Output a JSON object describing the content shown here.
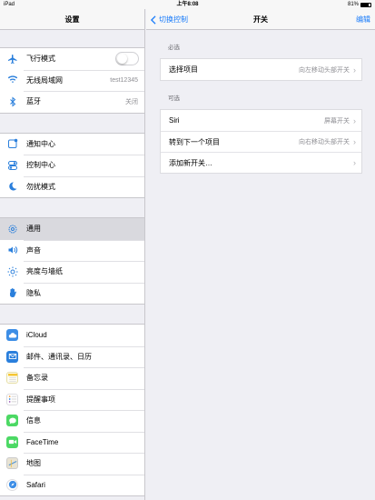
{
  "status_bar": {
    "device": "iPad",
    "time": "上午8:08",
    "battery": "81%",
    "battery_level": 0.81
  },
  "master": {
    "title": "设置",
    "groups": [
      [
        {
          "icon": "airplane-icon",
          "label": "飞行模式",
          "toggle": false
        },
        {
          "icon": "wifi-icon",
          "label": "无线局域网",
          "value": "test12345"
        },
        {
          "icon": "bluetooth-icon",
          "label": "蓝牙",
          "value": "关闭"
        }
      ],
      [
        {
          "icon": "notification-center-icon",
          "label": "通知中心"
        },
        {
          "icon": "control-center-icon",
          "label": "控制中心"
        },
        {
          "icon": "do-not-disturb-icon",
          "label": "勿扰模式"
        }
      ],
      [
        {
          "icon": "gear-icon",
          "label": "通用",
          "selected": true
        },
        {
          "icon": "speaker-icon",
          "label": "声音"
        },
        {
          "icon": "brightness-icon",
          "label": "亮度与墙纸"
        },
        {
          "icon": "hand-icon",
          "label": "隐私"
        }
      ],
      [
        {
          "icon": "icloud-icon",
          "label": "iCloud"
        },
        {
          "icon": "mail-icon",
          "label": "邮件、通讯录、日历"
        },
        {
          "icon": "notes-icon",
          "label": "备忘录"
        },
        {
          "icon": "reminders-icon",
          "label": "提醒事项"
        },
        {
          "icon": "messages-icon",
          "label": "信息"
        },
        {
          "icon": "facetime-icon",
          "label": "FaceTime"
        },
        {
          "icon": "maps-icon",
          "label": "地图"
        },
        {
          "icon": "safari-icon",
          "label": "Safari"
        }
      ]
    ]
  },
  "detail": {
    "back_label": "切换控制",
    "title": "开关",
    "edit_label": "编辑",
    "sections": [
      {
        "header": "必选",
        "rows": [
          {
            "label": "选择项目",
            "value": "向左移动头部开关"
          }
        ]
      },
      {
        "header": "可选",
        "rows": [
          {
            "label": "Siri",
            "value": "屏幕开关"
          },
          {
            "label": "转到下一个项目",
            "value": "向右移动头部开关"
          },
          {
            "label": "添加新开关…",
            "value": ""
          }
        ]
      }
    ]
  }
}
